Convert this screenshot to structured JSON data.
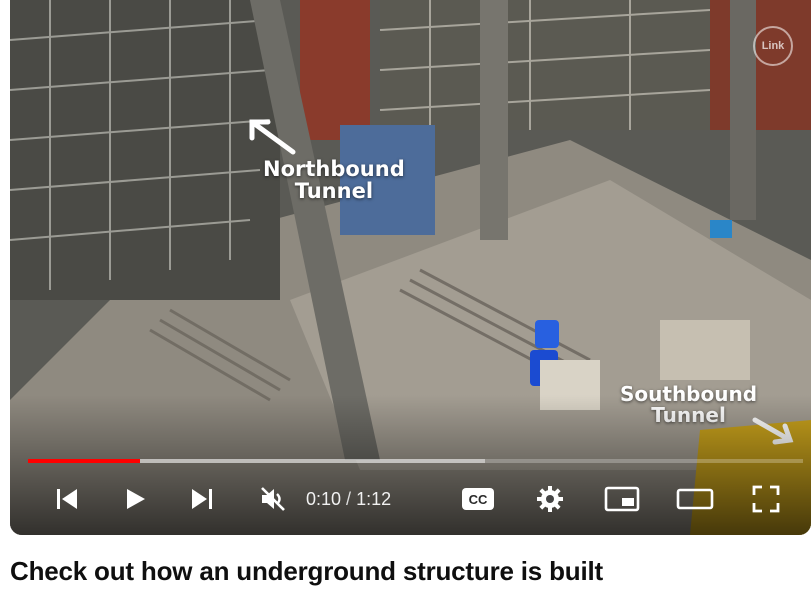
{
  "video": {
    "overlay_labels": {
      "northbound": "Northbound\nTunnel",
      "southbound": "Southbound\nTunnel"
    },
    "watermark_text": "Link",
    "progress": {
      "played_fraction": 0.145,
      "buffered_fraction": 0.59
    },
    "time": {
      "current": "0:10",
      "separator": " / ",
      "duration": "1:12"
    },
    "icons": {
      "previous": "previous-icon",
      "play": "play-icon",
      "next": "next-icon",
      "mute": "volume-muted-icon",
      "captions": "cc-icon",
      "settings": "gear-icon",
      "miniplayer": "miniplayer-icon",
      "theater": "theater-icon",
      "fullscreen": "fullscreen-icon"
    },
    "colors": {
      "progress_played": "#ff0000"
    }
  },
  "title": "Check out how an underground structure is built"
}
